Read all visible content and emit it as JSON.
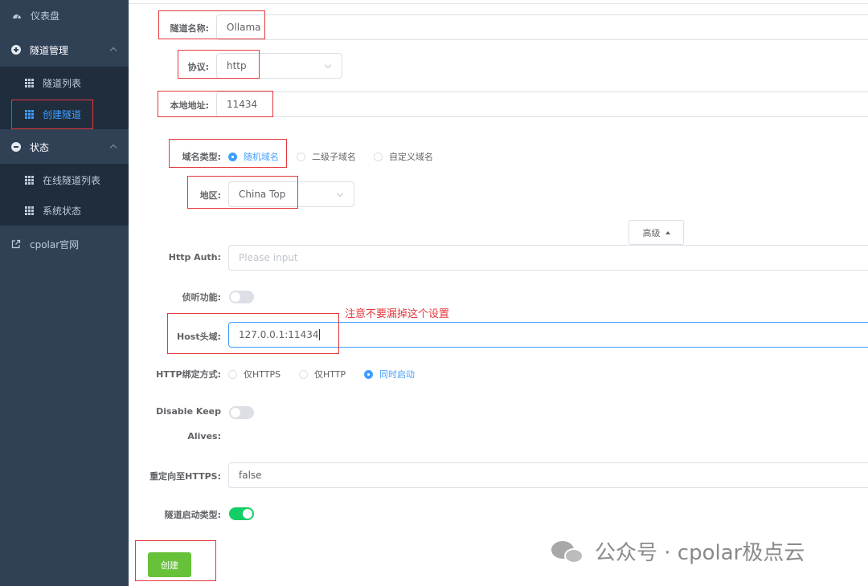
{
  "sidebar": {
    "items": [
      {
        "label": "仪表盘"
      },
      {
        "label": "隧道管理"
      },
      {
        "label": "隧道列表"
      },
      {
        "label": "创建隧道"
      },
      {
        "label": "状态"
      },
      {
        "label": "在线隧道列表"
      },
      {
        "label": "系统状态"
      },
      {
        "label": "cpolar官网"
      }
    ]
  },
  "form": {
    "tunnel_name": {
      "label": "隧道名称:",
      "value": "Ollama"
    },
    "protocol": {
      "label": "协议:",
      "value": "http"
    },
    "local_addr": {
      "label": "本地地址:",
      "value": "11434"
    },
    "domain_type": {
      "label": "域名类型:",
      "options": [
        "随机域名",
        "二级子域名",
        "自定义域名"
      ],
      "selected": "随机域名"
    },
    "region": {
      "label": "地区:",
      "value": "China Top"
    },
    "advanced_label": "高级",
    "http_auth": {
      "label": "Http Auth:",
      "placeholder": "Please input"
    },
    "listen": {
      "label": "侦听功能:",
      "enabled": false
    },
    "host_header": {
      "label": "Host头域:",
      "value": "127.0.0.1:11434"
    },
    "http_bind": {
      "label": "HTTP绑定方式:",
      "options": [
        "仅HTTPS",
        "仅HTTP",
        "同时启动"
      ],
      "selected": "同时启动"
    },
    "disable_keepalives": {
      "label_line1": "Disable Keep",
      "label_line2": "Alives:",
      "enabled": false
    },
    "redirect_https": {
      "label": "重定向至HTTPS:",
      "value": "false"
    },
    "tunnel_start_type": {
      "label": "隧道启动类型:",
      "enabled": true
    },
    "create_label": "创建"
  },
  "annotation": "注意不要漏掉这个设置",
  "watermark": "公众号 · cpolar极点云",
  "colors": {
    "sidebar_bg": "#304156",
    "submenu_bg": "#1f2d3d",
    "active": "#409eff",
    "success": "#67c23a",
    "annotation_red": "#e4393c"
  }
}
